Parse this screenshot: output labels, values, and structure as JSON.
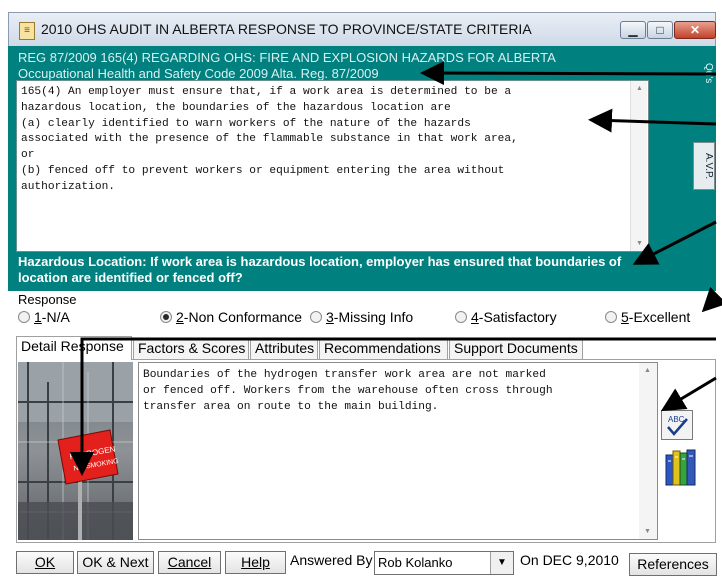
{
  "window": {
    "title": "2010 OHS AUDIT IN ALBERTA RESPONSE TO PROVINCE/STATE CRITERIA",
    "min_glyph": "▁",
    "max_glyph": "□",
    "close_glyph": "✕"
  },
  "regulation": {
    "heading": "REG 87/2009 165(4) REGARDING OHS:  FIRE AND EXPLOSION HAZARDS FOR ALBERTA",
    "code": "Occupational Health and Safety Code 2009 Alta. Reg. 87/2009",
    "text": "165(4) An employer must ensure that, if a work area is determined to be a\nhazardous location, the boundaries of the hazardous location are\n(a) clearly identified to warn workers of the nature of the hazards\nassociated with the presence of the flammable substance in that work area,\nor\n(b) fenced off to prevent workers or equipment entering the area without\nauthorization.",
    "criterion": "Hazardous Location:  If work area is hazardous location, employer has ensured that boundaries of location are identified or fenced off?"
  },
  "side_tabs": {
    "qus": "Qu's",
    "avp": "A.V.P."
  },
  "response": {
    "label": "Response",
    "options": [
      {
        "num": "1",
        "label": " -N/A",
        "selected": false
      },
      {
        "num": "2",
        "label": " -Non Conformance",
        "selected": true
      },
      {
        "num": "3",
        "label": " -Missing Info",
        "selected": false
      },
      {
        "num": "4",
        "label": " -Satisfactory",
        "selected": false
      },
      {
        "num": "5",
        "label": " -Excellent",
        "selected": false
      }
    ]
  },
  "tabs": [
    "Detail Response",
    "Factors & Scores",
    "Attributes",
    "Recommendations",
    "Support Documents"
  ],
  "detail": {
    "text": "Boundaries of the hydrogen transfer work area are not marked\nor fenced off. Workers from the warehouse often cross through\ntransfer area on route to the main building."
  },
  "photo_sign_text": "HYDROGEN",
  "buttons": {
    "ok": "OK",
    "ok_next": "OK & Next",
    "cancel": "Cancel",
    "help": "Help",
    "references": "References"
  },
  "answered_by": {
    "label": "Answered By",
    "value": "Rob Kolanko"
  },
  "date_text": "On DEC  9,2010",
  "colors": {
    "teal": "#00807f",
    "close_red": "#c3412a",
    "sign_red": "#e3201b"
  },
  "icons": [
    "document-icon",
    "minimize-icon",
    "maximize-icon",
    "close-icon",
    "spellcheck-icon",
    "books-icon",
    "dropdown-arrow-icon"
  ]
}
